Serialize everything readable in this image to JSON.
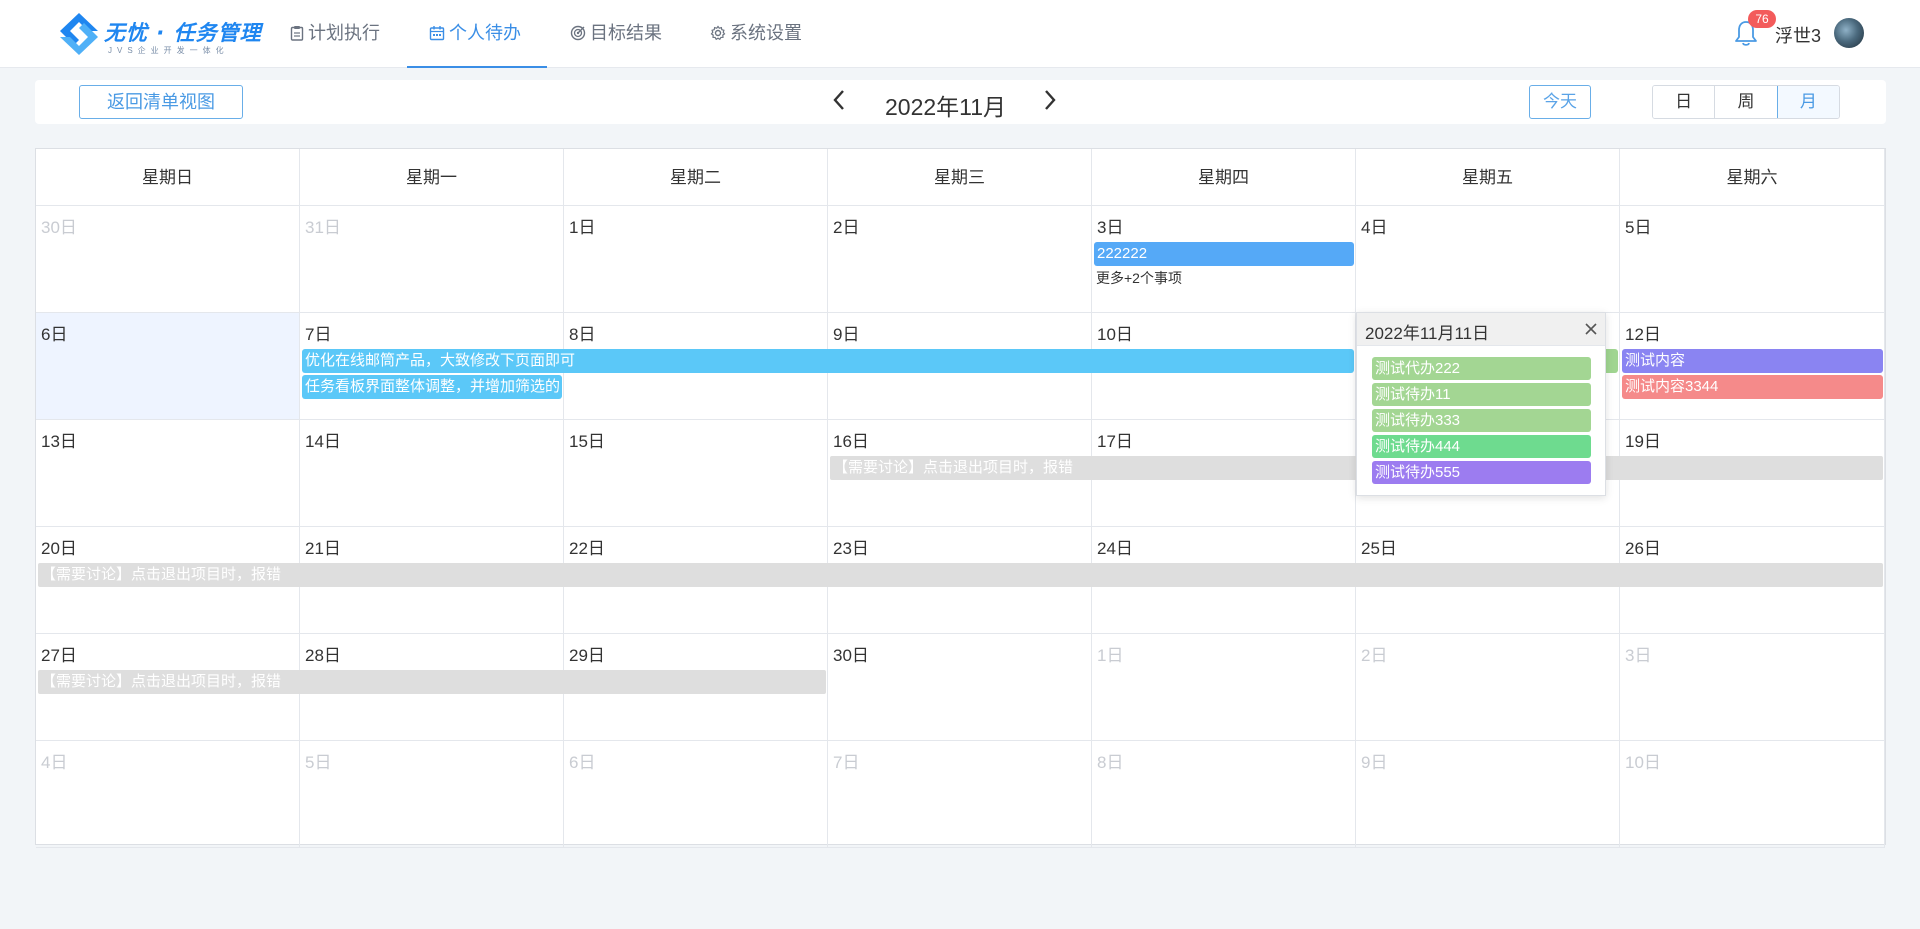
{
  "header": {
    "logo_title": "无忧 · 任务管理",
    "logo_sub": "JVS企业开发一体化",
    "nav": [
      {
        "label": "计划执行",
        "icon": "clipboard-icon"
      },
      {
        "label": "个人待办",
        "icon": "calendar-icon"
      },
      {
        "label": "目标结果",
        "icon": "target-icon"
      },
      {
        "label": "系统设置",
        "icon": "gear-icon"
      }
    ],
    "active_nav": "个人待办",
    "notification_count": "76",
    "username": "浮世3"
  },
  "toolbar": {
    "back_label": "返回清单视图",
    "month_title": "2022年11月",
    "today_label": "今天",
    "views": [
      "日",
      "周",
      "月"
    ],
    "active_view": "月"
  },
  "calendar": {
    "weekdays": [
      "星期日",
      "星期一",
      "星期二",
      "星期三",
      "星期四",
      "星期五",
      "星期六"
    ],
    "weeks": [
      [
        {
          "d": "30日",
          "other": true
        },
        {
          "d": "31日",
          "other": true
        },
        {
          "d": "1日"
        },
        {
          "d": "2日"
        },
        {
          "d": "3日"
        },
        {
          "d": "4日"
        },
        {
          "d": "5日"
        }
      ],
      [
        {
          "d": "6日",
          "today": true
        },
        {
          "d": "7日"
        },
        {
          "d": "8日"
        },
        {
          "d": "9日"
        },
        {
          "d": "10日"
        },
        {
          "d": "11日"
        },
        {
          "d": "12日"
        }
      ],
      [
        {
          "d": "13日"
        },
        {
          "d": "14日"
        },
        {
          "d": "15日"
        },
        {
          "d": "16日"
        },
        {
          "d": "17日"
        },
        {
          "d": "18日"
        },
        {
          "d": "19日"
        }
      ],
      [
        {
          "d": "20日"
        },
        {
          "d": "21日"
        },
        {
          "d": "22日"
        },
        {
          "d": "23日"
        },
        {
          "d": "24日"
        },
        {
          "d": "25日"
        },
        {
          "d": "26日"
        }
      ],
      [
        {
          "d": "27日"
        },
        {
          "d": "28日"
        },
        {
          "d": "29日"
        },
        {
          "d": "30日"
        },
        {
          "d": "1日",
          "other": true
        },
        {
          "d": "2日",
          "other": true
        },
        {
          "d": "3日",
          "other": true
        }
      ],
      [
        {
          "d": "4日",
          "other": true
        },
        {
          "d": "5日",
          "other": true
        },
        {
          "d": "6日",
          "other": true
        },
        {
          "d": "7日",
          "other": true
        },
        {
          "d": "8日",
          "other": true
        },
        {
          "d": "9日",
          "other": true
        },
        {
          "d": "10日",
          "other": true
        }
      ]
    ],
    "events": [
      {
        "title": "222222",
        "week": 0,
        "start": 4,
        "span": 1,
        "row": 0,
        "color": "#55a9f7"
      },
      {
        "title": "优化在线邮筒产品，大致修改下页面即可",
        "week": 1,
        "start": 1,
        "span": 4,
        "row": 0,
        "color": "#5bc8f8"
      },
      {
        "title": "",
        "week": 1,
        "start": 5,
        "span": 1,
        "row": 0,
        "color": "#a0d591"
      },
      {
        "title": "测试内容",
        "week": 1,
        "start": 6,
        "span": 1,
        "row": 0,
        "color": "#8a84f2"
      },
      {
        "title": "任务看板界面整体调整，并增加筛选的",
        "week": 1,
        "start": 1,
        "span": 1,
        "row": 1,
        "color": "#5bc8f8"
      },
      {
        "title": "测试内容3344",
        "week": 1,
        "start": 6,
        "span": 1,
        "row": 1,
        "color": "#f58a8a"
      },
      {
        "title": "【需要讨论】点击退出项目时，报错",
        "week": 2,
        "start": 3,
        "span": 4,
        "row": 0,
        "color": "#dedede",
        "muted": true
      },
      {
        "title": "【需要讨论】点击退出项目时，报错",
        "week": 3,
        "start": 0,
        "span": 7,
        "row": 0,
        "color": "#dedede",
        "muted": true
      },
      {
        "title": "【需要讨论】点击退出项目时，报错",
        "week": 4,
        "start": 0,
        "span": 3,
        "row": 0,
        "color": "#dedede",
        "muted": true
      }
    ],
    "more_links": [
      {
        "label": "更多+2个事项",
        "week": 0,
        "day": 4
      }
    ]
  },
  "popover": {
    "title": "2022年11月11日",
    "items": [
      {
        "label": "测试代办222",
        "color": "#a3d693"
      },
      {
        "label": "测试待办11",
        "color": "#a3d693"
      },
      {
        "label": "测试待办333",
        "color": "#a3d693"
      },
      {
        "label": "测试待办444",
        "color": "#6edb8f"
      },
      {
        "label": "测试待办555",
        "color": "#9c7cf0"
      }
    ]
  }
}
